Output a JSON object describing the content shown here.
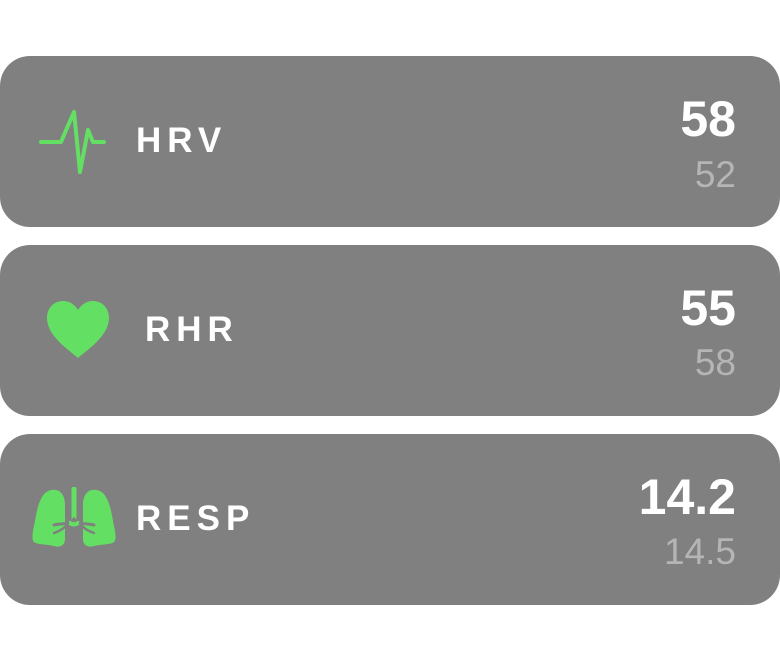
{
  "theme": {
    "card_color": "#808080",
    "accent_color": "#63E064",
    "primary_text_color": "#FFFFFF",
    "secondary_text_color": "#B5B5B5"
  },
  "metrics": [
    {
      "id": "hrv",
      "icon": "heartbeat-waveform-icon",
      "label": "HRV",
      "current": "58",
      "previous": "52"
    },
    {
      "id": "rhr",
      "icon": "heart-icon",
      "label": "RHR",
      "current": "55",
      "previous": "58"
    },
    {
      "id": "resp",
      "icon": "lungs-icon",
      "label": "RESP",
      "current": "14.2",
      "previous": "14.5"
    }
  ]
}
